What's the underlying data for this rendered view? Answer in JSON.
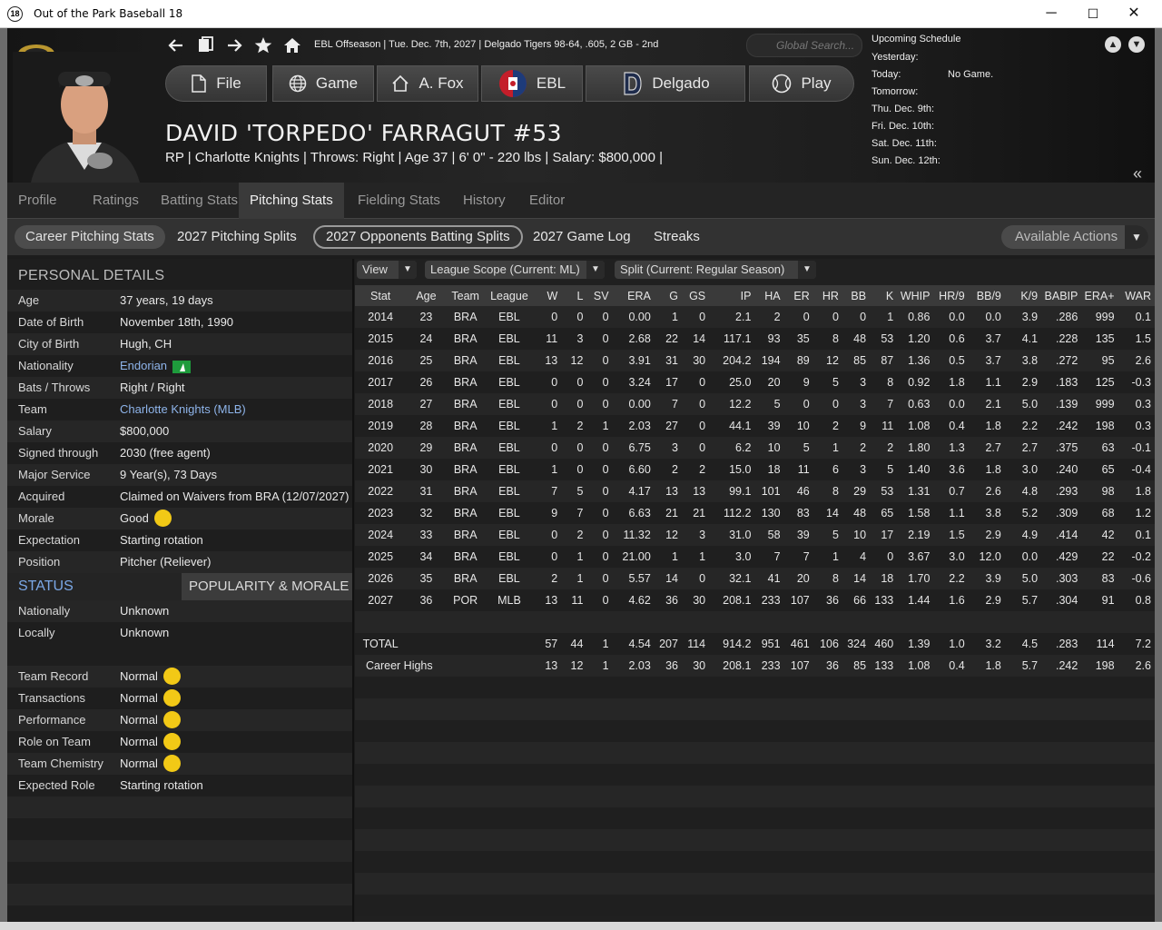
{
  "window": {
    "title": "Out of the Park Baseball 18",
    "icon_text": "18",
    "minimize": "─",
    "maximize": "☐",
    "close": "✕"
  },
  "header": {
    "status_line": "EBL Offseason  |  Tue. Dec. 7th, 2027  |  Delgado Tigers   98-64, .605, 2 GB - 2nd",
    "search_placeholder": "Global Search...",
    "buttons": {
      "file": "File",
      "game": "Game",
      "manager": "A. Fox",
      "league": "EBL",
      "team": "Delgado",
      "play": "Play"
    }
  },
  "player": {
    "name": "DAVID 'TORPEDO' FARRAGUT  #53",
    "info": "RP | Charlotte Knights  |  Throws: Right  |  Age 37  |  6' 0\" - 220 lbs  |  Salary: $800,000  |"
  },
  "schedule": {
    "title": "Upcoming Schedule",
    "rows": [
      {
        "day": "Yesterday:",
        "value": ""
      },
      {
        "day": "Today:",
        "value": "No Game."
      },
      {
        "day": "Tomorrow:",
        "value": ""
      },
      {
        "day": "Thu. Dec. 9th:",
        "value": ""
      },
      {
        "day": "Fri. Dec. 10th:",
        "value": ""
      },
      {
        "day": "Sat. Dec. 11th:",
        "value": ""
      },
      {
        "day": "Sun. Dec. 12th:",
        "value": ""
      }
    ]
  },
  "main_tabs": [
    "Profile",
    "Ratings",
    "Batting Stats",
    "Pitching Stats",
    "Fielding Stats",
    "History",
    "Editor"
  ],
  "sub_tabs": [
    "Career Pitching Stats",
    "2027 Pitching Splits",
    "2027 Opponents Batting Splits",
    "2027 Game Log",
    "Streaks"
  ],
  "available_actions": "Available Actions",
  "personal": {
    "title": "PERSONAL DETAILS",
    "rows": [
      {
        "key": "Age",
        "value": "37 years, 19 days"
      },
      {
        "key": "Date of Birth",
        "value": "November 18th, 1990"
      },
      {
        "key": "City of Birth",
        "value": "Hugh, CH"
      },
      {
        "key": "Nationality",
        "value": "Endorian"
      },
      {
        "key": "Bats / Throws",
        "value": "Right / Right"
      },
      {
        "key": "Team",
        "value": "Charlotte Knights (MLB)"
      },
      {
        "key": "Salary",
        "value": "$800,000"
      },
      {
        "key": "Signed through",
        "value": "2030 (free agent)"
      },
      {
        "key": "Major Service",
        "value": "9 Year(s), 73 Days"
      },
      {
        "key": "Acquired",
        "value": "Claimed on Waivers from BRA (12/07/2027)"
      },
      {
        "key": "Morale",
        "value": "Good"
      },
      {
        "key": "Expectation",
        "value": "Starting rotation"
      },
      {
        "key": "Position",
        "value": "Pitcher (Reliever)"
      }
    ]
  },
  "status": {
    "tab": "STATUS",
    "other_tab": "POPULARITY & MORALE",
    "rows": [
      {
        "key": "Nationally",
        "value": "Unknown"
      },
      {
        "key": "Locally",
        "value": "Unknown"
      }
    ],
    "morale_rows": [
      {
        "key": "Team Record",
        "value": "Normal"
      },
      {
        "key": "Transactions",
        "value": "Normal"
      },
      {
        "key": "Performance",
        "value": "Normal"
      },
      {
        "key": "Role on Team",
        "value": "Normal"
      },
      {
        "key": "Team Chemistry",
        "value": "Normal"
      },
      {
        "key": "Expected Role",
        "value": "Starting rotation"
      }
    ]
  },
  "filters": {
    "view": "View",
    "scope": "League Scope  (Current: ML)",
    "split": "Split  (Current: Regular Season)"
  },
  "table": {
    "columns": [
      "Stat",
      "Age",
      "Team",
      "League",
      "W",
      "L",
      "SV",
      "ERA",
      "G",
      "GS",
      "IP",
      "HA",
      "ER",
      "HR",
      "BB",
      "K",
      "WHIP",
      "HR/9",
      "BB/9",
      "K/9",
      "BABIP",
      "ERA+",
      "WAR"
    ],
    "rows": [
      [
        "2014",
        "23",
        "BRA",
        "EBL",
        "0",
        "0",
        "0",
        "0.00",
        "1",
        "0",
        "2.1",
        "2",
        "0",
        "0",
        "0",
        "1",
        "0.86",
        "0.0",
        "0.0",
        "3.9",
        ".286",
        "999",
        "0.1"
      ],
      [
        "2015",
        "24",
        "BRA",
        "EBL",
        "11",
        "3",
        "0",
        "2.68",
        "22",
        "14",
        "117.1",
        "93",
        "35",
        "8",
        "48",
        "53",
        "1.20",
        "0.6",
        "3.7",
        "4.1",
        ".228",
        "135",
        "1.5"
      ],
      [
        "2016",
        "25",
        "BRA",
        "EBL",
        "13",
        "12",
        "0",
        "3.91",
        "31",
        "30",
        "204.2",
        "194",
        "89",
        "12",
        "85",
        "87",
        "1.36",
        "0.5",
        "3.7",
        "3.8",
        ".272",
        "95",
        "2.6"
      ],
      [
        "2017",
        "26",
        "BRA",
        "EBL",
        "0",
        "0",
        "0",
        "3.24",
        "17",
        "0",
        "25.0",
        "20",
        "9",
        "5",
        "3",
        "8",
        "0.92",
        "1.8",
        "1.1",
        "2.9",
        ".183",
        "125",
        "-0.3"
      ],
      [
        "2018",
        "27",
        "BRA",
        "EBL",
        "0",
        "0",
        "0",
        "0.00",
        "7",
        "0",
        "12.2",
        "5",
        "0",
        "0",
        "3",
        "7",
        "0.63",
        "0.0",
        "2.1",
        "5.0",
        ".139",
        "999",
        "0.3"
      ],
      [
        "2019",
        "28",
        "BRA",
        "EBL",
        "1",
        "2",
        "1",
        "2.03",
        "27",
        "0",
        "44.1",
        "39",
        "10",
        "2",
        "9",
        "11",
        "1.08",
        "0.4",
        "1.8",
        "2.2",
        ".242",
        "198",
        "0.3"
      ],
      [
        "2020",
        "29",
        "BRA",
        "EBL",
        "0",
        "0",
        "0",
        "6.75",
        "3",
        "0",
        "6.2",
        "10",
        "5",
        "1",
        "2",
        "2",
        "1.80",
        "1.3",
        "2.7",
        "2.7",
        ".375",
        "63",
        "-0.1"
      ],
      [
        "2021",
        "30",
        "BRA",
        "EBL",
        "1",
        "0",
        "0",
        "6.60",
        "2",
        "2",
        "15.0",
        "18",
        "11",
        "6",
        "3",
        "5",
        "1.40",
        "3.6",
        "1.8",
        "3.0",
        ".240",
        "65",
        "-0.4"
      ],
      [
        "2022",
        "31",
        "BRA",
        "EBL",
        "7",
        "5",
        "0",
        "4.17",
        "13",
        "13",
        "99.1",
        "101",
        "46",
        "8",
        "29",
        "53",
        "1.31",
        "0.7",
        "2.6",
        "4.8",
        ".293",
        "98",
        "1.8"
      ],
      [
        "2023",
        "32",
        "BRA",
        "EBL",
        "9",
        "7",
        "0",
        "6.63",
        "21",
        "21",
        "112.2",
        "130",
        "83",
        "14",
        "48",
        "65",
        "1.58",
        "1.1",
        "3.8",
        "5.2",
        ".309",
        "68",
        "1.2"
      ],
      [
        "2024",
        "33",
        "BRA",
        "EBL",
        "0",
        "2",
        "0",
        "11.32",
        "12",
        "3",
        "31.0",
        "58",
        "39",
        "5",
        "10",
        "17",
        "2.19",
        "1.5",
        "2.9",
        "4.9",
        ".414",
        "42",
        "0.1"
      ],
      [
        "2025",
        "34",
        "BRA",
        "EBL",
        "0",
        "1",
        "0",
        "21.00",
        "1",
        "1",
        "3.0",
        "7",
        "7",
        "1",
        "4",
        "0",
        "3.67",
        "3.0",
        "12.0",
        "0.0",
        ".429",
        "22",
        "-0.2"
      ],
      [
        "2026",
        "35",
        "BRA",
        "EBL",
        "2",
        "1",
        "0",
        "5.57",
        "14",
        "0",
        "32.1",
        "41",
        "20",
        "8",
        "14",
        "18",
        "1.70",
        "2.2",
        "3.9",
        "5.0",
        ".303",
        "83",
        "-0.6"
      ],
      [
        "2027",
        "36",
        "POR",
        "MLB",
        "13",
        "11",
        "0",
        "4.62",
        "36",
        "30",
        "208.1",
        "233",
        "107",
        "36",
        "66",
        "133",
        "1.44",
        "1.6",
        "2.9",
        "5.7",
        ".304",
        "91",
        "0.8"
      ]
    ],
    "total": [
      "TOTAL",
      "",
      "",
      "",
      "57",
      "44",
      "1",
      "4.54",
      "207",
      "114",
      "914.2",
      "951",
      "461",
      "106",
      "324",
      "460",
      "1.39",
      "1.0",
      "3.2",
      "4.5",
      ".283",
      "114",
      "7.2"
    ],
    "highs": [
      "Career Highs",
      "",
      "",
      "",
      "13",
      "12",
      "1",
      "2.03",
      "36",
      "30",
      "208.1",
      "233",
      "107",
      "36",
      "85",
      "133",
      "1.08",
      "0.4",
      "1.8",
      "5.7",
      ".242",
      "198",
      "2.6"
    ]
  }
}
